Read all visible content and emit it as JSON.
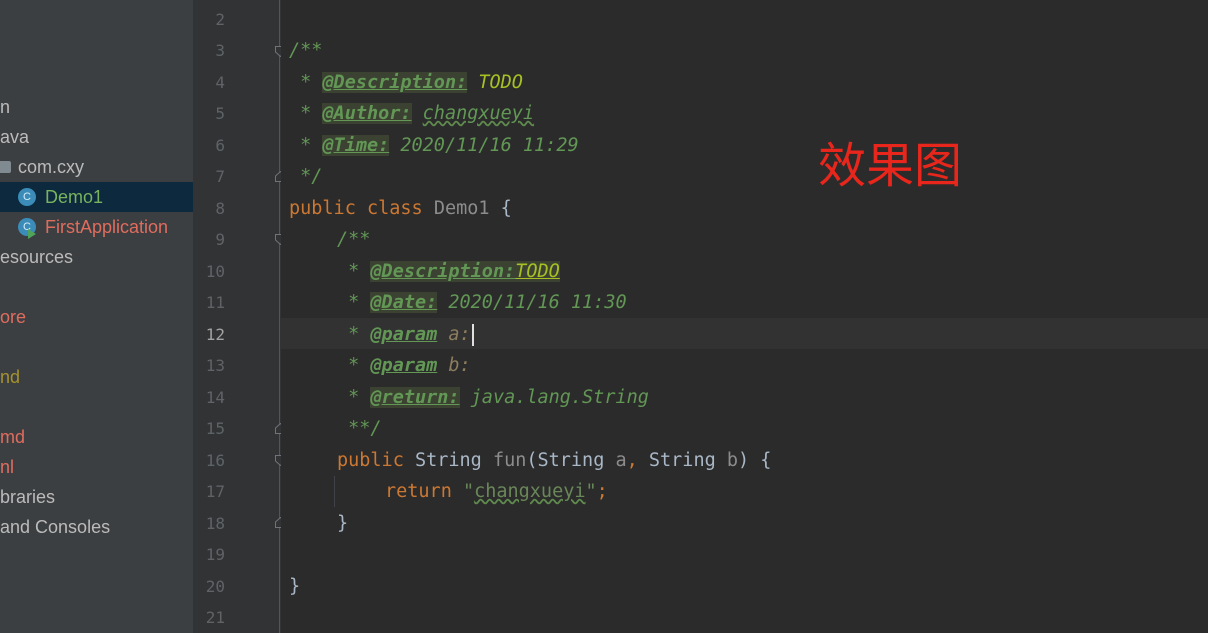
{
  "project_tree": {
    "items": [
      {
        "label": "n",
        "color": "default"
      },
      {
        "label": "ava",
        "color": "default"
      },
      {
        "label": "com.cxy",
        "color": "default",
        "icon": "package-folder-icon"
      },
      {
        "label": "Demo1",
        "color": "selected",
        "icon": "java-class-icon",
        "selected": true
      },
      {
        "label": "FirstApplication",
        "color": "red",
        "icon": "spring-boot-class-icon"
      },
      {
        "label": "esources",
        "color": "default"
      },
      {
        "label": "ore",
        "color": "red"
      },
      {
        "label": "nd",
        "color": "olive"
      },
      {
        "label": "md",
        "color": "red"
      },
      {
        "label": "nl",
        "color": "red"
      },
      {
        "label": "braries",
        "color": "default"
      },
      {
        "label": "and Consoles",
        "color": "default"
      }
    ],
    "class_icon_letter": "C"
  },
  "editor": {
    "line_numbers": [
      "2",
      "3",
      "4",
      "5",
      "6",
      "7",
      "8",
      "9",
      "10",
      "11",
      "12",
      "13",
      "14",
      "15",
      "16",
      "17",
      "18",
      "19",
      "20",
      "21"
    ],
    "current_line": "12",
    "doc1": {
      "open": "/**",
      "star": " * ",
      "desc_tag": "@Description:",
      "desc_value": " TODO",
      "author_tag": "@Author:",
      "author_value": "changxueyi",
      "time_tag": "@Time:",
      "time_value": " 2020/11/16 11:29",
      "close": " */"
    },
    "class_decl": {
      "kw1": "public",
      "kw2": "class",
      "name": "Demo1",
      "brace": " {"
    },
    "doc2": {
      "open": "/**",
      "star": " * ",
      "desc_tag": "@Description:",
      "desc_value": "TODO",
      "date_tag": "@Date:",
      "date_value": " 2020/11/16 11:30",
      "param_tag": "@param",
      "param_a": " a:",
      "param_b": " b:",
      "return_tag": "@return:",
      "return_value": " java.lang.String",
      "close": " **/"
    },
    "method_decl": {
      "kw": "public",
      "type1": "String",
      "name": "fun",
      "open": "(",
      "type2": "String",
      "param_a": "a",
      "comma": ", ",
      "type3": "String",
      "param_b": "b",
      "close": ") {"
    },
    "return_stmt": {
      "kw": "return",
      "quote_open": "\"",
      "value": "changxueyi",
      "quote_close": "\"",
      "semicolon": ";"
    },
    "method_close": "}",
    "class_close": "}"
  },
  "annotation_label": "效果图",
  "colors": {
    "keyword": "#cc7832",
    "doc_comment": "#629755",
    "string": "#6a8759",
    "annotation_red": "#e8261c"
  }
}
